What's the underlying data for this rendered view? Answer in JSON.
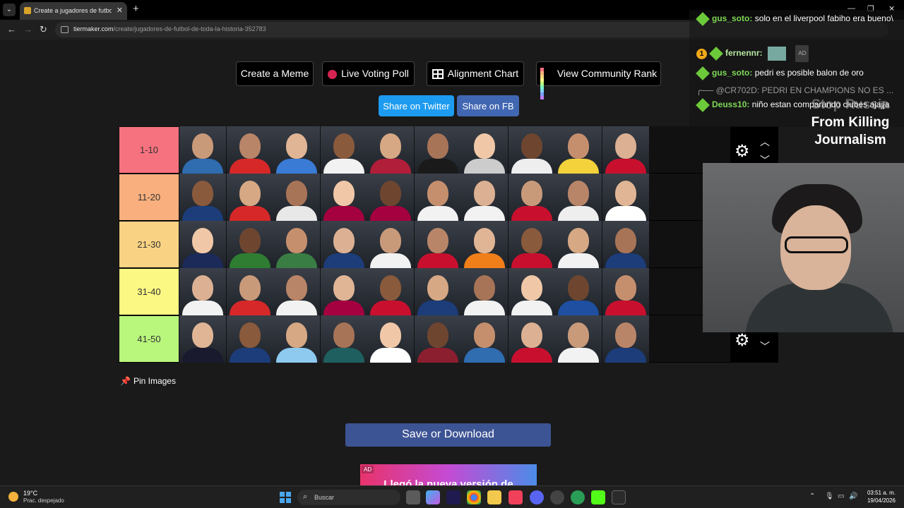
{
  "browser": {
    "tab_title": "Create a jugadores de futbol de toda la historia",
    "url_host": "tiermaker.com",
    "url_path": "/create/jugadores-de-futbol-de-toda-la-historia-352783"
  },
  "actions": {
    "create_meme": "Create a Meme",
    "live_voting": "Live Voting Poll",
    "alignment_chart": "Alignment Chart",
    "community_rank": "View Community Rank",
    "share_twitter": "Share on Twitter",
    "share_fb": "Share on FB"
  },
  "tiers": [
    {
      "label": "1-10",
      "color": "#f7727f",
      "count": 10
    },
    {
      "label": "11-20",
      "color": "#f9b07e",
      "count": 10
    },
    {
      "label": "21-30",
      "color": "#f9d383",
      "count": 10
    },
    {
      "label": "31-40",
      "color": "#fbf883",
      "count": 10
    },
    {
      "label": "41-50",
      "color": "#b9f67c",
      "count": 10
    }
  ],
  "pin_images": "Pin Images",
  "save_download": "Save or Download",
  "ad": {
    "tag": "AD",
    "text": "Llegó la nueva versión de"
  },
  "chat": {
    "messages": [
      {
        "user": "gus_soto:",
        "text": "solo en el liverpool fabiho era bueno\\"
      },
      {
        "user": "fernennr:",
        "text": ""
      },
      {
        "user": "gus_soto:",
        "text": "pedri es posible balon de oro"
      },
      {
        "user": "@CR702D:",
        "text": "PEDRI EN CHAMPIONS NO ES ..."
      },
      {
        "user": "Deuss10:",
        "text": "niño estan comparando clubes ajajja"
      }
    ],
    "ad_chip": "AD",
    "coin": "1"
  },
  "side_text": {
    "line1": "Stop Russia",
    "line2": "From Killing",
    "line3": "Journalism"
  },
  "taskbar": {
    "temp": "19°C",
    "weather": "Prac. despejado",
    "search_placeholder": "Buscar",
    "time": "03:51 a. m.",
    "date": "19/04/2026"
  }
}
